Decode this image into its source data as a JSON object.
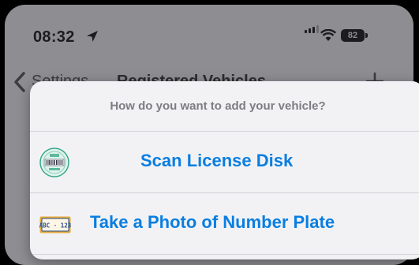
{
  "status_bar": {
    "time": "08:32",
    "battery_level": "82"
  },
  "nav_bar": {
    "back_label": "Settings",
    "title": "Registered Vehicles"
  },
  "action_sheet": {
    "header": "How do you want to add your vehicle?",
    "options": [
      {
        "label": "Scan License Disk",
        "icon": "license-disk-icon"
      },
      {
        "label": "Take a Photo of Number Plate",
        "icon": "number-plate-icon"
      }
    ]
  },
  "colors": {
    "accent": "#0a7ee0",
    "dimmed_background": "#8e8d92",
    "sheet_background": "#f2f2f5"
  }
}
